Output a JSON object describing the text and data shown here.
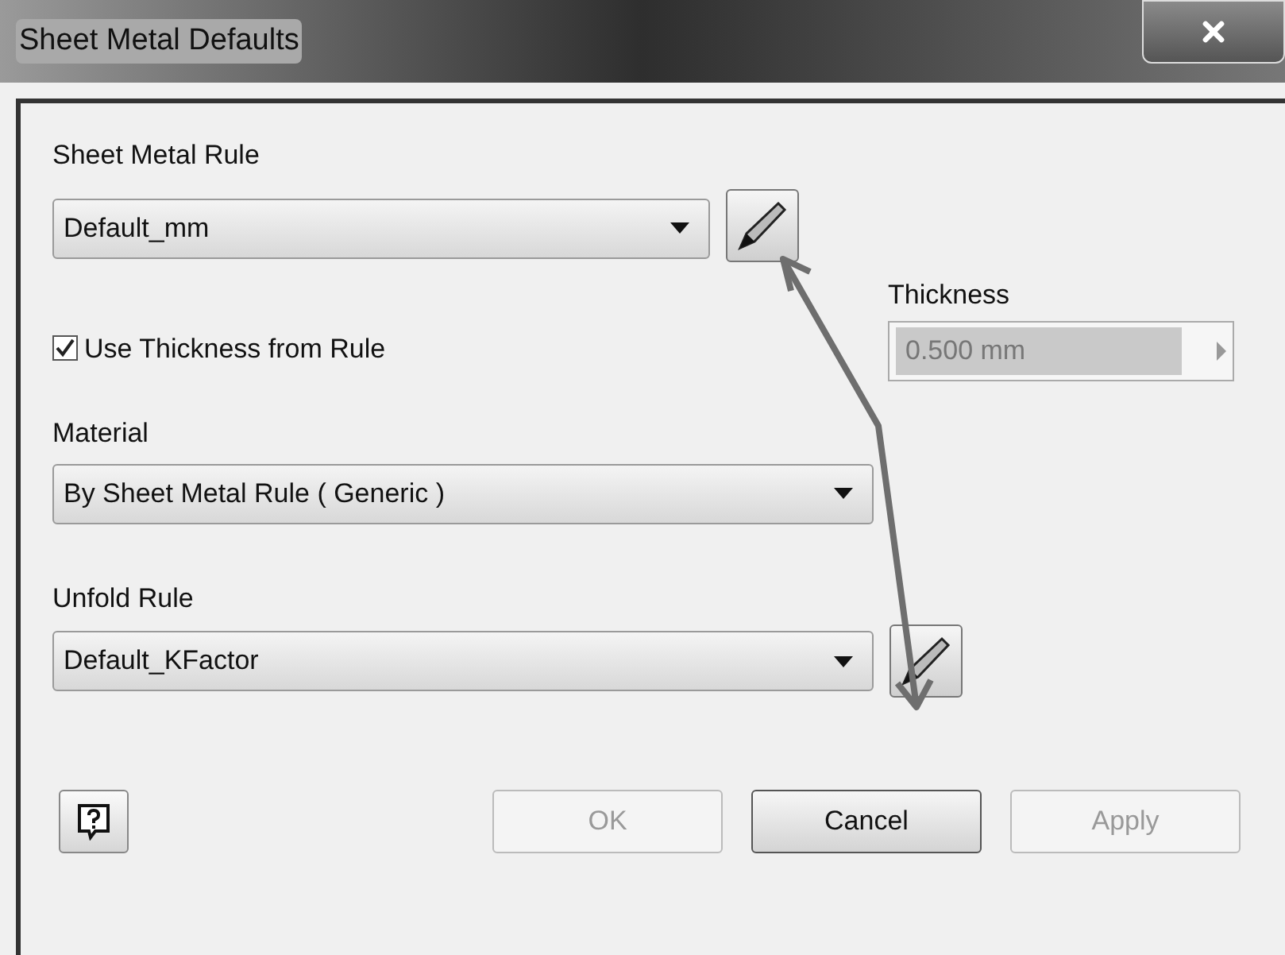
{
  "window": {
    "title": "Sheet Metal Defaults"
  },
  "sheet_metal_rule": {
    "label": "Sheet Metal Rule",
    "value": "Default_mm"
  },
  "thickness": {
    "label": "Thickness",
    "value": "0.500 mm",
    "disabled": true
  },
  "use_thickness": {
    "label": "Use Thickness from Rule",
    "checked": true
  },
  "material": {
    "label": "Material",
    "value": "By Sheet Metal Rule ( Generic )"
  },
  "unfold_rule": {
    "label": "Unfold Rule",
    "value": "Default_KFactor"
  },
  "buttons": [
    {
      "label": "OK",
      "disabled": true
    },
    {
      "label": "Cancel",
      "disabled": false
    },
    {
      "label": "Apply",
      "disabled": true
    }
  ]
}
